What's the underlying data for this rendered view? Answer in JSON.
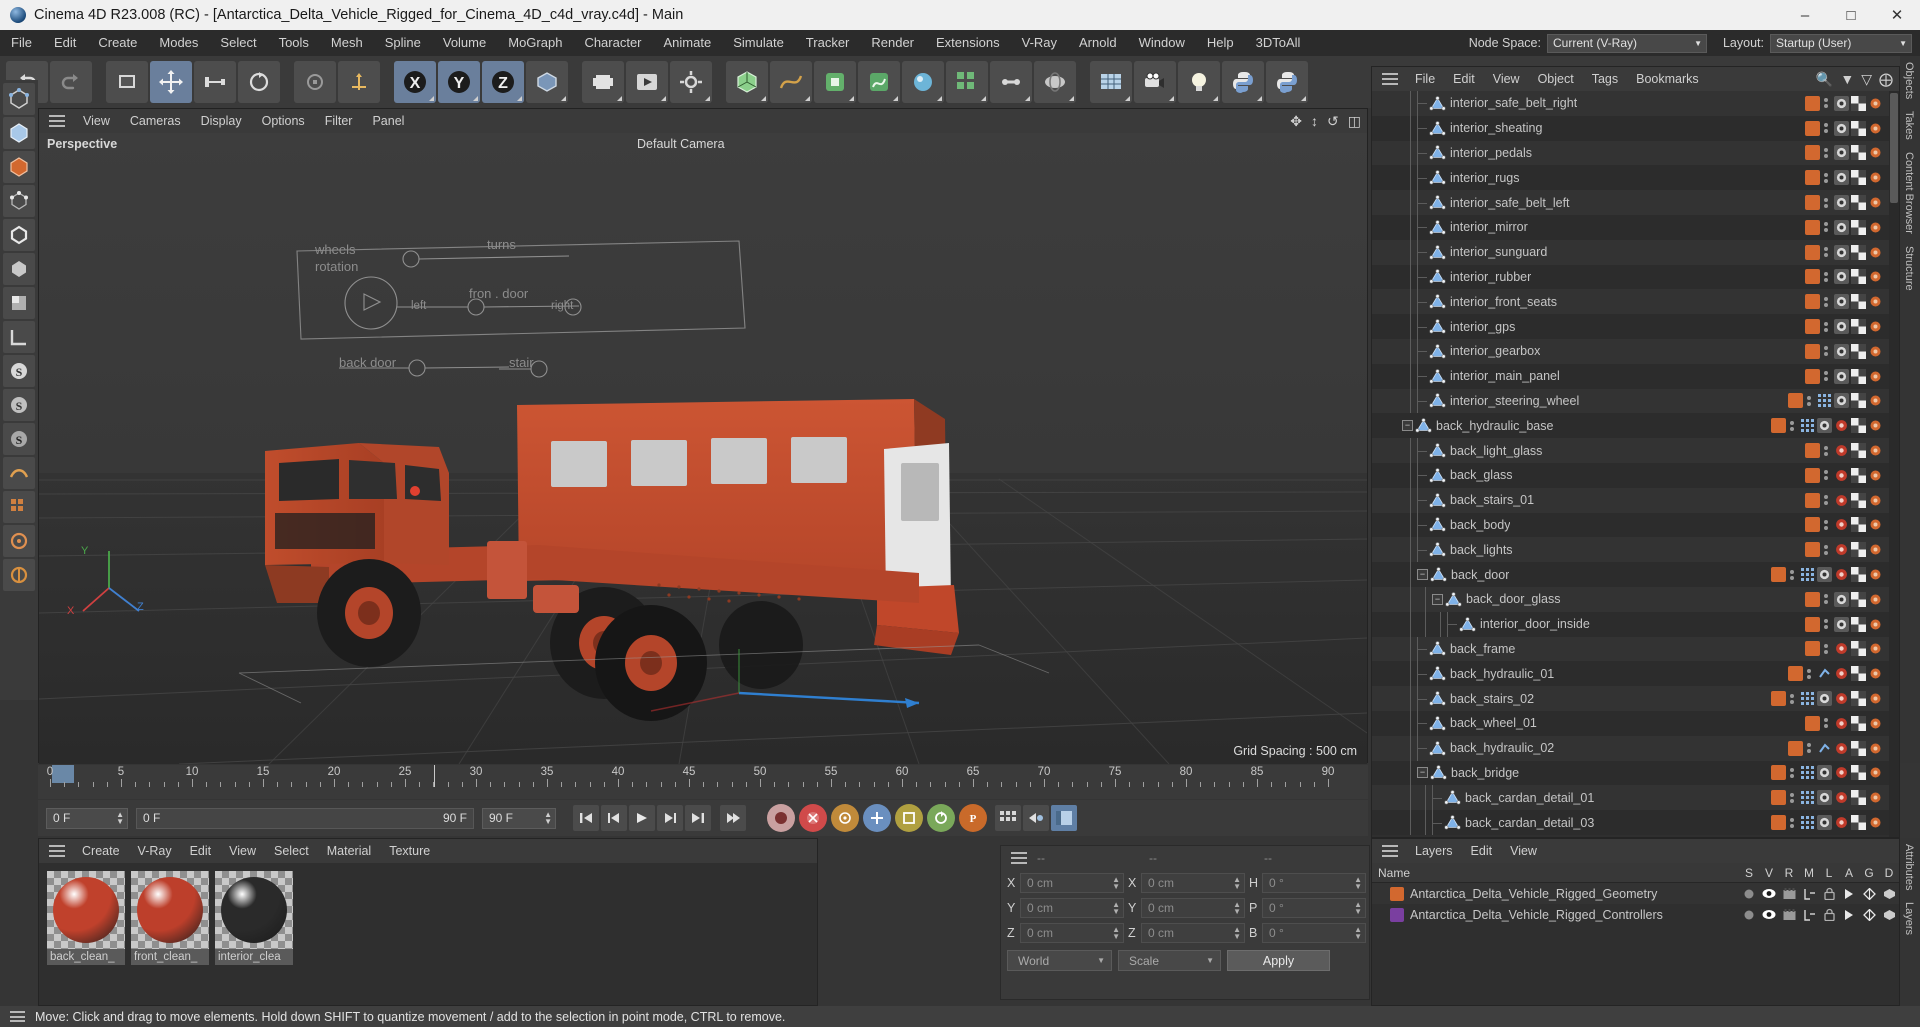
{
  "window": {
    "title": "Cinema 4D R23.008 (RC) - [Antarctica_Delta_Vehicle_Rigged_for_Cinema_4D_c4d_vray.c4d] - Main",
    "minimize": "–",
    "maximize": "□",
    "close": "✕"
  },
  "menubar": {
    "items": [
      "File",
      "Edit",
      "Create",
      "Modes",
      "Select",
      "Tools",
      "Mesh",
      "Spline",
      "Volume",
      "MoGraph",
      "Character",
      "Animate",
      "Simulate",
      "Tracker",
      "Render",
      "Extensions",
      "V-Ray",
      "Arnold",
      "Window",
      "Help",
      "3DToAll"
    ],
    "node_space_label": "Node Space:",
    "node_space_value": "Current (V-Ray)",
    "layout_label": "Layout:",
    "layout_value": "Startup (User)"
  },
  "viewport": {
    "menu": [
      "View",
      "Cameras",
      "Display",
      "Options",
      "Filter",
      "Panel"
    ],
    "perspective_label": "Perspective",
    "camera_label": "Default Camera",
    "grid_spacing": "Grid Spacing : 500 cm",
    "hud": {
      "wheels_rotation": "wheels\nrotation",
      "turns": "turns",
      "front_door": "fron . door",
      "left": "left",
      "right": "right",
      "back_door": "back door",
      "stair": "stair"
    },
    "axis": {
      "x": "X",
      "y": "Y",
      "z": "Z"
    }
  },
  "object_manager": {
    "menu": [
      "File",
      "Edit",
      "View",
      "Object",
      "Tags",
      "Bookmarks"
    ],
    "items": [
      {
        "name": "interior_safe_belt_right",
        "depth": 2,
        "expander": "none",
        "tagset": "a"
      },
      {
        "name": "interior_sheating",
        "depth": 2,
        "expander": "none",
        "tagset": "a"
      },
      {
        "name": "interior_pedals",
        "depth": 2,
        "expander": "none",
        "tagset": "a"
      },
      {
        "name": "interior_rugs",
        "depth": 2,
        "expander": "none",
        "tagset": "a"
      },
      {
        "name": "interior_safe_belt_left",
        "depth": 2,
        "expander": "none",
        "tagset": "a"
      },
      {
        "name": "interior_mirror",
        "depth": 2,
        "expander": "none",
        "tagset": "a"
      },
      {
        "name": "interior_sunguard",
        "depth": 2,
        "expander": "none",
        "tagset": "a"
      },
      {
        "name": "interior_rubber",
        "depth": 2,
        "expander": "none",
        "tagset": "a"
      },
      {
        "name": "interior_front_seats",
        "depth": 2,
        "expander": "none",
        "tagset": "a"
      },
      {
        "name": "interior_gps",
        "depth": 2,
        "expander": "none",
        "tagset": "a"
      },
      {
        "name": "interior_gearbox",
        "depth": 2,
        "expander": "none",
        "tagset": "a"
      },
      {
        "name": "interior_main_panel",
        "depth": 2,
        "expander": "none",
        "tagset": "a"
      },
      {
        "name": "interior_steering_wheel",
        "depth": 2,
        "expander": "none",
        "tagset": "b"
      },
      {
        "name": "back_hydraulic_base",
        "depth": 1,
        "expander": "minus",
        "tagset": "c"
      },
      {
        "name": "back_light_glass",
        "depth": 2,
        "expander": "none",
        "tagset": "d"
      },
      {
        "name": "back_glass",
        "depth": 2,
        "expander": "none",
        "tagset": "d"
      },
      {
        "name": "back_stairs_01",
        "depth": 2,
        "expander": "none",
        "tagset": "d"
      },
      {
        "name": "back_body",
        "depth": 2,
        "expander": "none",
        "tagset": "d"
      },
      {
        "name": "back_lights",
        "depth": 2,
        "expander": "none",
        "tagset": "d"
      },
      {
        "name": "back_door",
        "depth": 2,
        "expander": "minus",
        "tagset": "c"
      },
      {
        "name": "back_door_glass",
        "depth": 3,
        "expander": "minus",
        "tagset": "a"
      },
      {
        "name": "interior_door_inside",
        "depth": 4,
        "expander": "none",
        "tagset": "a"
      },
      {
        "name": "back_frame",
        "depth": 2,
        "expander": "none",
        "tagset": "d"
      },
      {
        "name": "back_hydraulic_01",
        "depth": 2,
        "expander": "none",
        "tagset": "e"
      },
      {
        "name": "back_stairs_02",
        "depth": 2,
        "expander": "none",
        "tagset": "c"
      },
      {
        "name": "back_wheel_01",
        "depth": 2,
        "expander": "none",
        "tagset": "d"
      },
      {
        "name": "back_hydraulic_02",
        "depth": 2,
        "expander": "none",
        "tagset": "e"
      },
      {
        "name": "back_bridge",
        "depth": 2,
        "expander": "minus",
        "tagset": "c"
      },
      {
        "name": "back_cardan_detail_01",
        "depth": 3,
        "expander": "none",
        "tagset": "c"
      },
      {
        "name": "back_cardan_detail_03",
        "depth": 3,
        "expander": "none",
        "tagset": "c"
      }
    ]
  },
  "timeline": {
    "ticks": [
      0,
      5,
      10,
      15,
      20,
      25,
      30,
      35,
      40,
      45,
      50,
      55,
      60,
      65,
      70,
      75,
      80,
      85,
      90
    ],
    "current_frame": "0 F",
    "range_start": "0 F",
    "range_end": "90 F",
    "preview_end": "90 F",
    "max_frame": "90 F",
    "playhead": 0
  },
  "material_manager": {
    "menu": [
      "Create",
      "V-Ray",
      "Edit",
      "View",
      "Select",
      "Material",
      "Texture"
    ],
    "materials": [
      {
        "name": "back_clean_",
        "color": "#c0412c",
        "selected": true
      },
      {
        "name": "front_clean_",
        "color": "#bd3f2b",
        "selected": true
      },
      {
        "name": "interior_clea",
        "color": "#2a2a2a",
        "selected": true
      }
    ]
  },
  "coordinates": {
    "header_dashes": [
      "--",
      "--",
      "--"
    ],
    "position": {
      "labels": [
        "X",
        "Y",
        "Z"
      ],
      "values": [
        "0 cm",
        "0 cm",
        "0 cm"
      ]
    },
    "size": {
      "labels": [
        "X",
        "Y",
        "Z"
      ],
      "values": [
        "0 cm",
        "0 cm",
        "0 cm"
      ]
    },
    "rotation": {
      "labels": [
        "H",
        "P",
        "B"
      ],
      "values": [
        "0 °",
        "0 °",
        "0 °"
      ]
    },
    "coord_system": "World",
    "mode": "Scale",
    "apply_label": "Apply"
  },
  "layer_manager": {
    "menu": [
      "Layers",
      "Edit",
      "View"
    ],
    "columns": [
      "Name",
      "S",
      "V",
      "R",
      "M",
      "L",
      "A",
      "G",
      "D"
    ],
    "rows": [
      {
        "name": "Antarctica_Delta_Vehicle_Rigged_Geometry",
        "color": "#d2682f"
      },
      {
        "name": "Antarctica_Delta_Vehicle_Rigged_Controllers",
        "color": "#7a3fa0"
      }
    ]
  },
  "right_tabs": [
    "Objects",
    "Takes",
    "Content Browser",
    "Structure"
  ],
  "dock_tabs_bottom": [
    "Attributes",
    "Layers"
  ],
  "status_bar": {
    "text": "Move: Click and drag to move elements. Hold down SHIFT to quantize movement / add to the selection in point mode, CTRL to remove."
  },
  "colors": {
    "accent_orange": "#d2682f",
    "accent_purple": "#7a3fa0",
    "selection_blue": "#6a7f9c",
    "vehicle_red": "#c0412c"
  }
}
